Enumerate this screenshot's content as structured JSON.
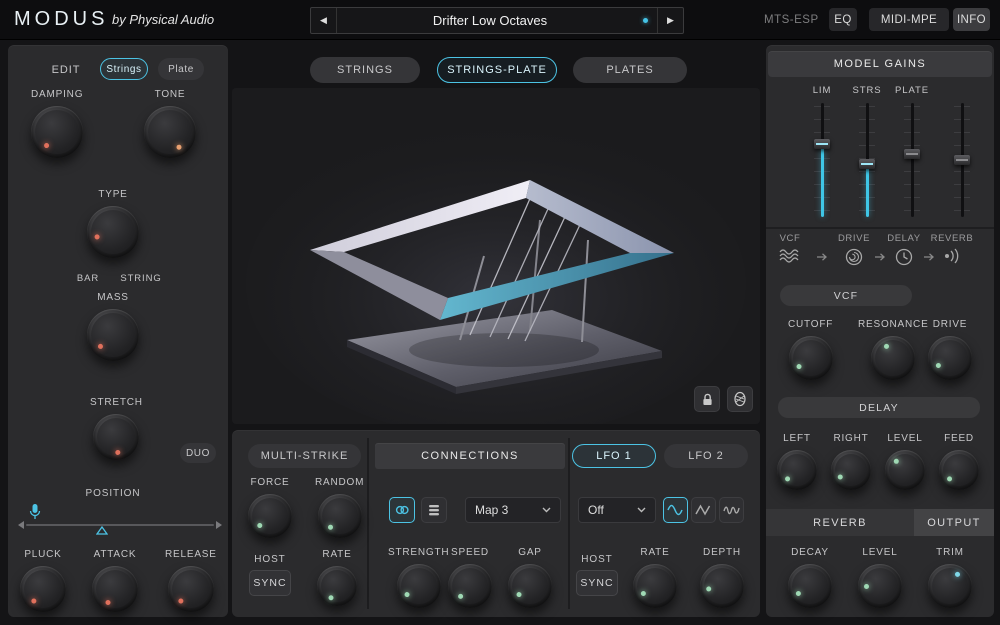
{
  "header": {
    "logo": "MODUS",
    "byline": "by Physical Audio",
    "prev_arrow": "◀",
    "next_arrow": "▶",
    "preset_name": "Drifter Low Octaves",
    "mts_esp": "MTS-ESP",
    "eq_label": "EQ",
    "midi_mpe_label": "MIDI-MPE",
    "info_label": "INFO"
  },
  "edit_panel": {
    "edit_label": "EDIT",
    "strings_toggle": "Strings",
    "plate_toggle": "Plate",
    "damping_label": "DAMPING",
    "tone_label": "TONE",
    "type_label": "TYPE",
    "bar_label": "BAR",
    "string_label": "STRING",
    "mass_label": "MASS",
    "stretch_label": "STRETCH",
    "duo_label": "DUO",
    "position_label": "POSITION",
    "pluck_label": "PLUCK",
    "attack_label": "ATTACK",
    "release_label": "RELEASE"
  },
  "model_tabs": {
    "strings": "STRINGS",
    "strings_plate": "STRINGS-PLATE",
    "plates": "PLATES"
  },
  "multi_strike": {
    "title": "MULTI-STRIKE",
    "force_label": "FORCE",
    "random_label": "RANDOM",
    "host_label": "HOST",
    "sync_label": "SYNC",
    "rate_label": "RATE"
  },
  "connections": {
    "title": "CONNECTIONS",
    "map_value": "Map 3",
    "strength_label": "STRENGTH",
    "speed_label": "SPEED",
    "gap_label": "GAP"
  },
  "lfo": {
    "lfo1_label": "LFO 1",
    "lfo2_label": "LFO 2",
    "target_value": "Off",
    "host_label": "HOST",
    "sync_label": "SYNC",
    "rate_label": "RATE",
    "depth_label": "DEPTH"
  },
  "model_gains": {
    "title": "MODEL GAINS",
    "fader_labels": [
      "LIM",
      "STRS",
      "PLATE"
    ]
  },
  "fx": {
    "chain": [
      "VCF",
      "DRIVE",
      "DELAY",
      "REVERB"
    ],
    "vcf_button": "VCF",
    "cutoff_label": "CUTOFF",
    "resonance_label": "RESONANCE",
    "drive_label": "DRIVE",
    "delay_button": "DELAY",
    "left_label": "LEFT",
    "right_label": "RIGHT",
    "level_label": "LEVEL",
    "feed_label": "FEED",
    "reverb_tab": "REVERB",
    "output_tab": "OUTPUT",
    "decay_label": "DECAY",
    "level2_label": "LEVEL",
    "trim_label": "TRIM"
  },
  "colors": {
    "accent": "#45c3e6",
    "warm_dot": "#e07a66",
    "green_dot": "#9fd9b4"
  }
}
